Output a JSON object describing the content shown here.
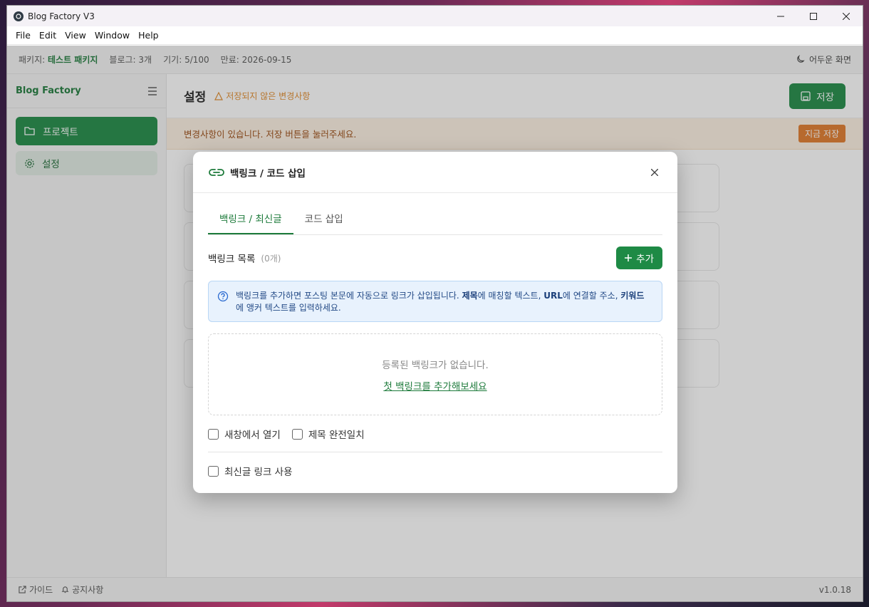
{
  "window": {
    "title": "Blog Factory V3"
  },
  "menu": [
    "File",
    "Edit",
    "View",
    "Window",
    "Help"
  ],
  "pkgbar": {
    "package_label": "패키지:",
    "package_value": "테스트 패키지",
    "blog_label": "블로그:",
    "blog_value": "3개",
    "device_label": "기기:",
    "device_value": "5/100",
    "expiry_label": "만료:",
    "expiry_value": "2026-09-15",
    "dark_mode": "어두운 화면"
  },
  "sidebar": {
    "brand": "Blog Factory",
    "items": [
      {
        "label": "프로젝트",
        "icon": "folder-open-icon"
      },
      {
        "label": "설정",
        "icon": "gear-icon"
      }
    ]
  },
  "main": {
    "title": "설정",
    "unsaved": "저장되지 않은 변경사항",
    "save_label": "저장",
    "warning_text": "변경사항이 있습니다. 저장 버튼을 눌러주세요.",
    "save_now": "지금 저장"
  },
  "status": {
    "guide": "가이드",
    "notice": "공지사항",
    "version": "v1.0.18"
  },
  "modal": {
    "title": "백링크 / 코드 삽입",
    "tabs": [
      "백링크 / 최신글",
      "코드 삽입"
    ],
    "list_title": "백링크 목록",
    "list_count": "(0개)",
    "add_label": "추가",
    "info": {
      "t1": "백링크를 추가하면 포스팅 본문에 자동으로 링크가 삽입됩니다. ",
      "b1": "제목",
      "t2": "에 매칭할 텍스트, ",
      "b2": "URL",
      "t3": "에 연결할 주소, ",
      "b3": "키워드",
      "t4": "에 앵커 텍스트를 입력하세요."
    },
    "empty_text": "등록된 백링크가 없습니다.",
    "empty_link": "첫 백링크를 추가해보세요",
    "check_new_window": "새창에서 열기",
    "check_exact_title": "제목 완전일치",
    "check_latest": "최신글 링크 사용"
  },
  "colors": {
    "brand_green": "#1e8a45",
    "warning_orange": "#e07a2a",
    "info_blue": "#e8f2fd"
  }
}
